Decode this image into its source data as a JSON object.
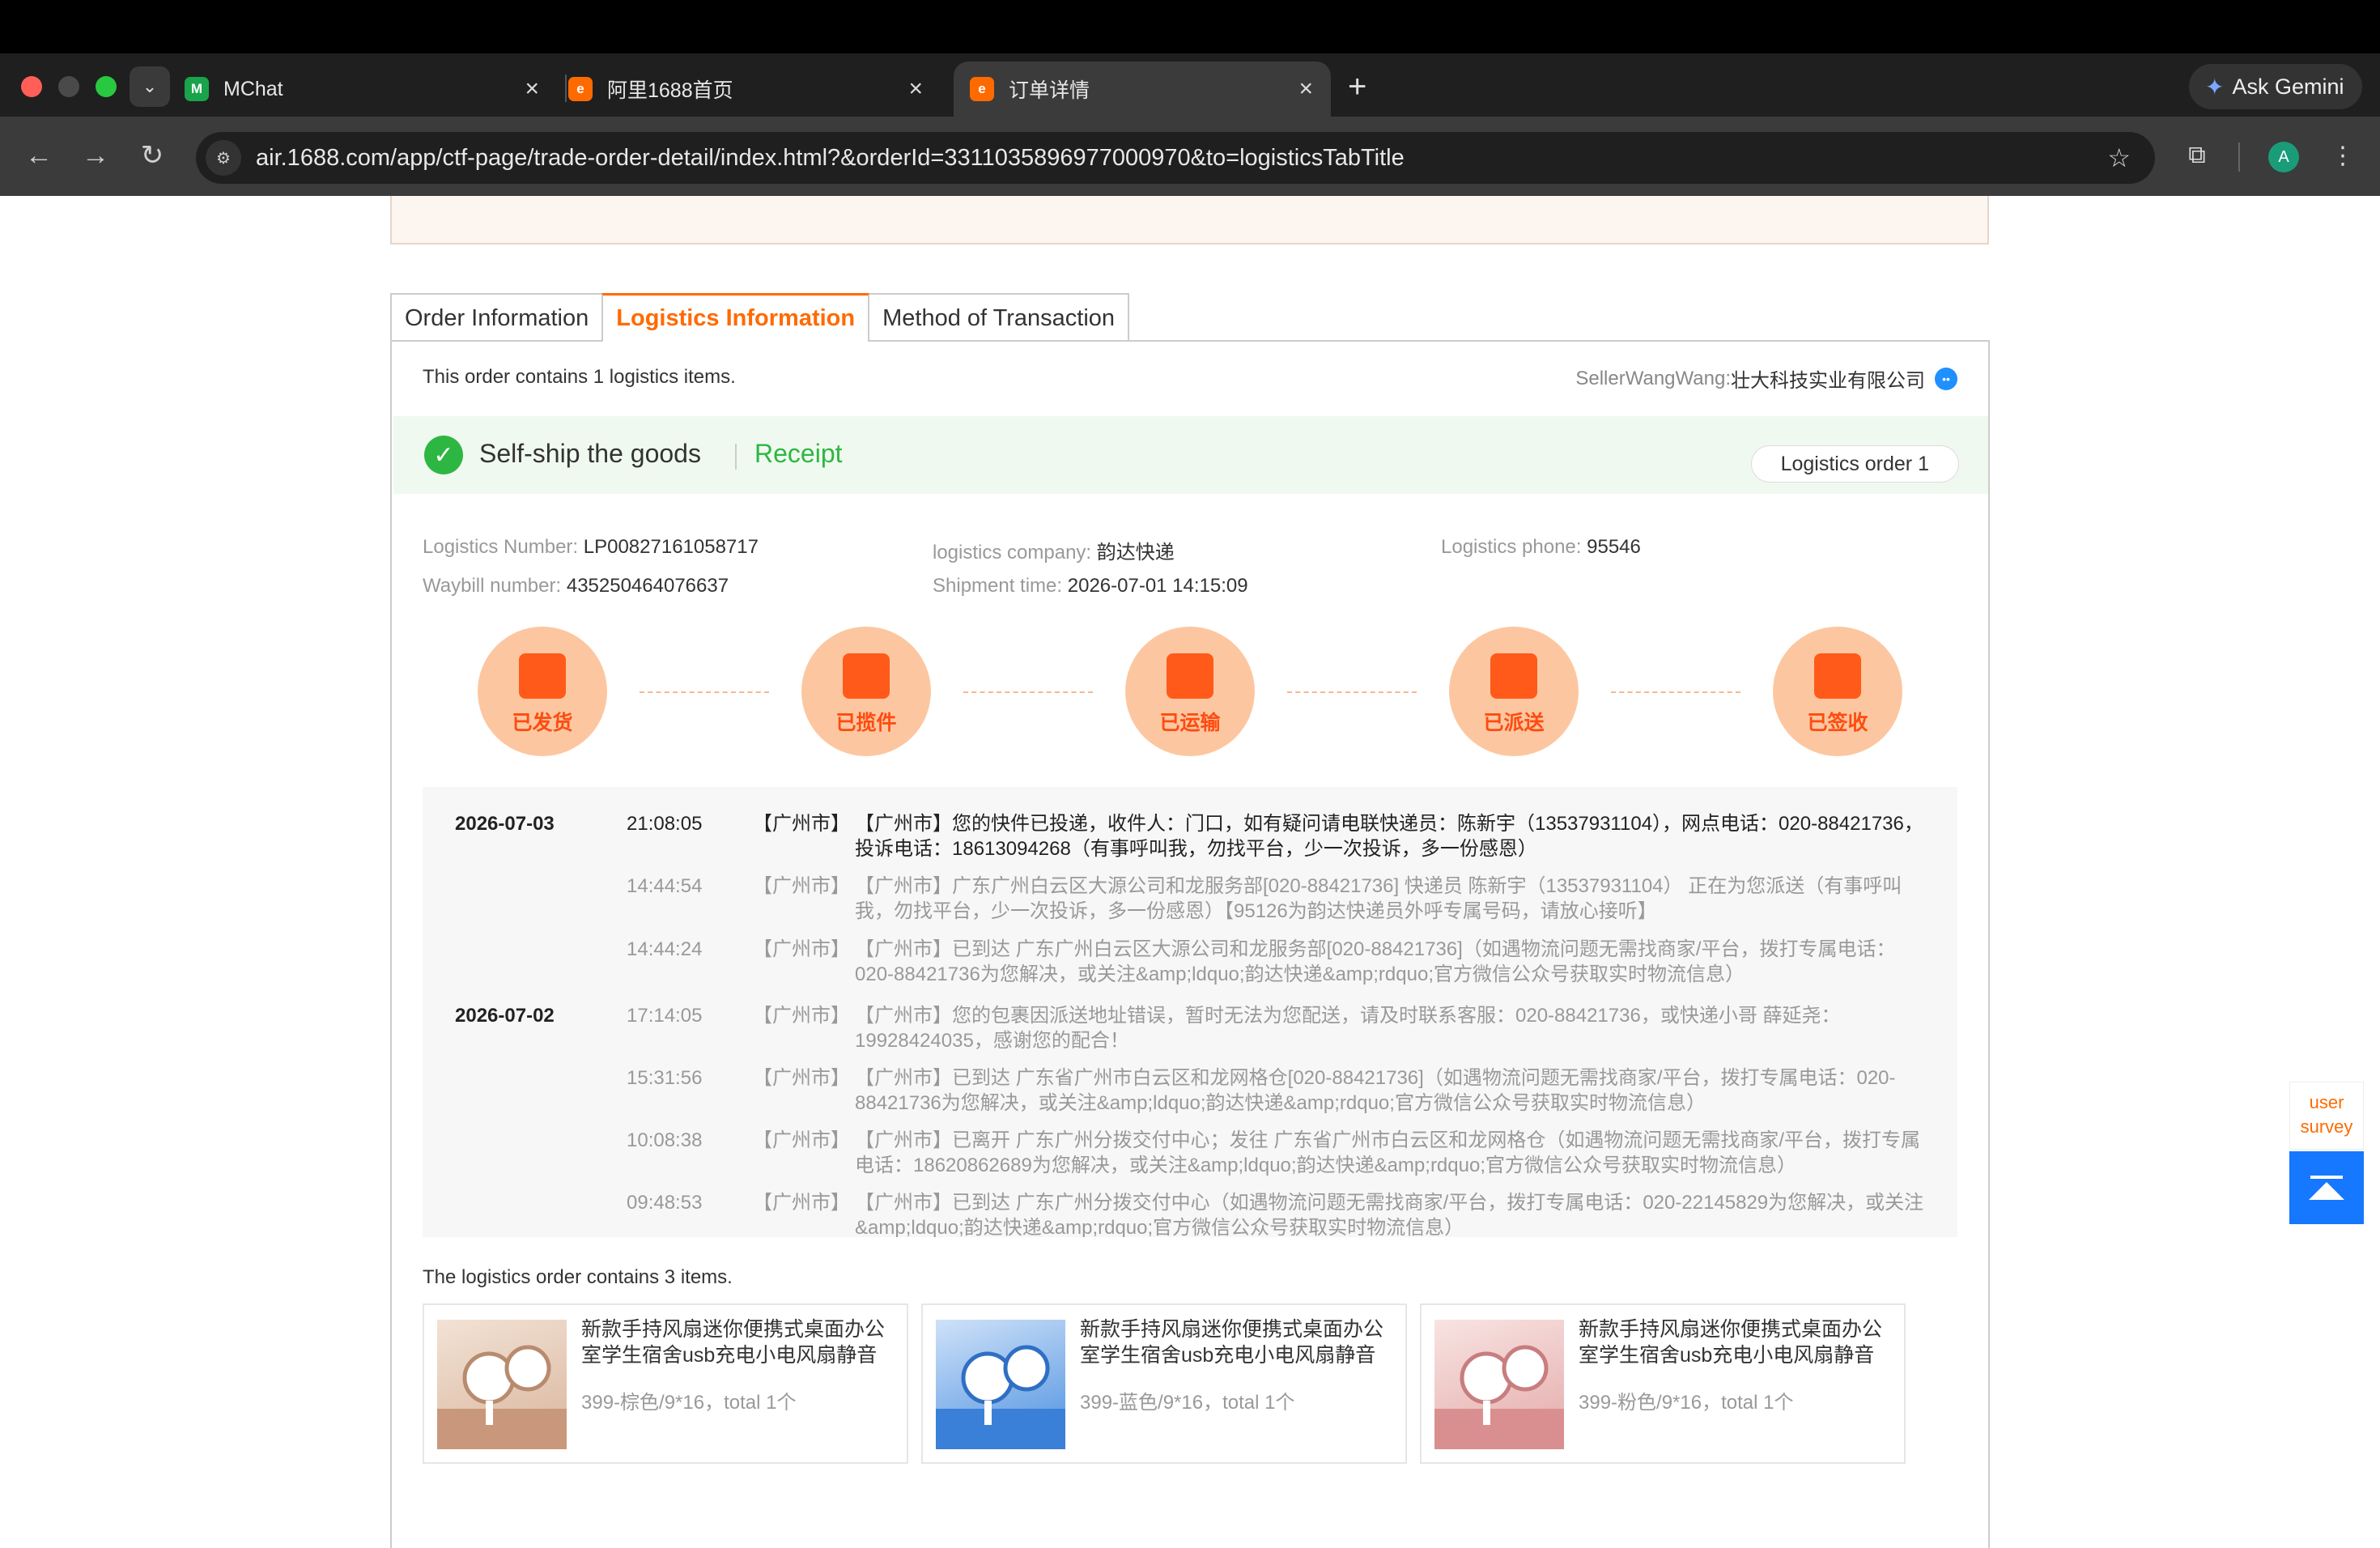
{
  "browser": {
    "tabs": [
      {
        "title": "MChat",
        "favicon_color": "#19a34a",
        "favicon_glyph": "M"
      },
      {
        "title": "阿里1688首页",
        "favicon_color": "#ff6a00",
        "favicon_glyph": "e"
      },
      {
        "title": "订单详情",
        "favicon_color": "#ff6a00",
        "favicon_glyph": "e"
      }
    ],
    "active_tab_index": 2,
    "ask_gemini": "Ask Gemini",
    "url": "air.1688.com/app/ctf-page/trade-order-detail/index.html?&orderId=3311035896977000970&to=logisticsTabTitle",
    "avatar_letter": "A",
    "accent_green": "#1a9c79"
  },
  "page": {
    "tabs": [
      "Order Information",
      "Logistics Information",
      "Method of Transaction"
    ],
    "active_tab": "Logistics Information",
    "contains_text": "This order contains 1 logistics items.",
    "seller_label": "SellerWangWang:",
    "seller_name": "壮大科技实业有限公司",
    "status": {
      "title": "Self-ship the goods",
      "state": "Receipt",
      "logistics_order_button": "Logistics order 1"
    },
    "info": {
      "logistics_number_label": "Logistics Number:",
      "logistics_number": "LP00827161058717",
      "company_label": "logistics company:",
      "company": "韵达快递",
      "phone_label": "Logistics phone:",
      "phone": "95546",
      "waybill_label": "Waybill number:",
      "waybill": "435250464076637",
      "shipment_label": "Shipment time:",
      "shipment": "2026-07-01 14:15:09"
    },
    "steps": [
      {
        "label": "已发货",
        "icon": "package-icon"
      },
      {
        "label": "已揽件",
        "icon": "clipboard-list-icon"
      },
      {
        "label": "已运输",
        "icon": "truck-icon"
      },
      {
        "label": "已派送",
        "icon": "courier-icon"
      },
      {
        "label": "已签收",
        "icon": "signed-clipboard-icon"
      }
    ],
    "tracking": [
      {
        "date": "2026-07-03",
        "time": "21:08:05",
        "city": "【广州市】",
        "desc": "【广州市】您的快件已投递，收件人：门口，如有疑问请电联快递员：陈新宇（13537931104），网点电话：020-88421736，投诉电话：18613094268（有事呼叫我，勿找平台，少一次投诉，多一份感恩）"
      },
      {
        "date": "",
        "time": "14:44:54",
        "city": "【广州市】",
        "desc": "【广州市】广东广州白云区大源公司和龙服务部[020-88421736] 快递员 陈新宇（13537931104） 正在为您派送（有事呼叫我，勿找平台，少一次投诉，多一份感恩）【95126为韵达快递员外呼专属号码，请放心接听】"
      },
      {
        "date": "",
        "time": "14:44:24",
        "city": "【广州市】",
        "desc": "【广州市】已到达 广东广州白云区大源公司和龙服务部[020-88421736]（如遇物流问题无需找商家/平台，拨打专属电话：020-88421736为您解决，或关注&amp;ldquo;韵达快递&amp;rdquo;官方微信公众号获取实时物流信息）"
      },
      {
        "date": "2026-07-02",
        "time": "17:14:05",
        "city": "【广州市】",
        "desc": "【广州市】您的包裹因派送地址错误，暂时无法为您配送，请及时联系客服：020-88421736，或快递小哥 薛延尧：19928424035，感谢您的配合！"
      },
      {
        "date": "",
        "time": "15:31:56",
        "city": "【广州市】",
        "desc": "【广州市】已到达 广东省广州市白云区和龙网格仓[020-88421736]（如遇物流问题无需找商家/平台，拨打专属电话：020-88421736为您解决，或关注&amp;ldquo;韵达快递&amp;rdquo;官方微信公众号获取实时物流信息）"
      },
      {
        "date": "",
        "time": "10:08:38",
        "city": "【广州市】",
        "desc": "【广州市】已离开 广东广州分拨交付中心；发往 广东省广州市白云区和龙网格仓（如遇物流问题无需找商家/平台，拨打专属电话：18620862689为您解决，或关注&amp;ldquo;韵达快递&amp;rdquo;官方微信公众号获取实时物流信息）"
      },
      {
        "date": "",
        "time": "09:48:53",
        "city": "【广州市】",
        "desc": "【广州市】已到达 广东广州分拨交付中心（如遇物流问题无需找商家/平台，拨打专属电话：020-22145829为您解决，或关注&amp;ldquo;韵达快递&amp;rdquo;官方微信公众号获取实时物流信息）"
      }
    ],
    "items_label": "The logistics order contains 3 items.",
    "products": [
      {
        "name": "新款手持风扇迷你便携式桌面办公室学生宿舍usb充电小电风扇静音",
        "spec": "399-棕色/9*16，total 1个",
        "color": "#b98b6e",
        "bg": "#e9d4c4"
      },
      {
        "name": "新款手持风扇迷你便携式桌面办公室学生宿舍usb充电小电风扇静音",
        "spec": "399-蓝色/9*16，total 1个",
        "color": "#3a7fd8",
        "bg": "#b9d4f3"
      },
      {
        "name": "新款手持风扇迷你便携式桌面办公室学生宿舍usb充电小电风扇静音",
        "spec": "399-粉色/9*16，total 1个",
        "color": "#d98f90",
        "bg": "#f3d7d5"
      }
    ],
    "survey": "user survey",
    "accent_orange": "#ff6a00",
    "status_green": "#2db742"
  }
}
